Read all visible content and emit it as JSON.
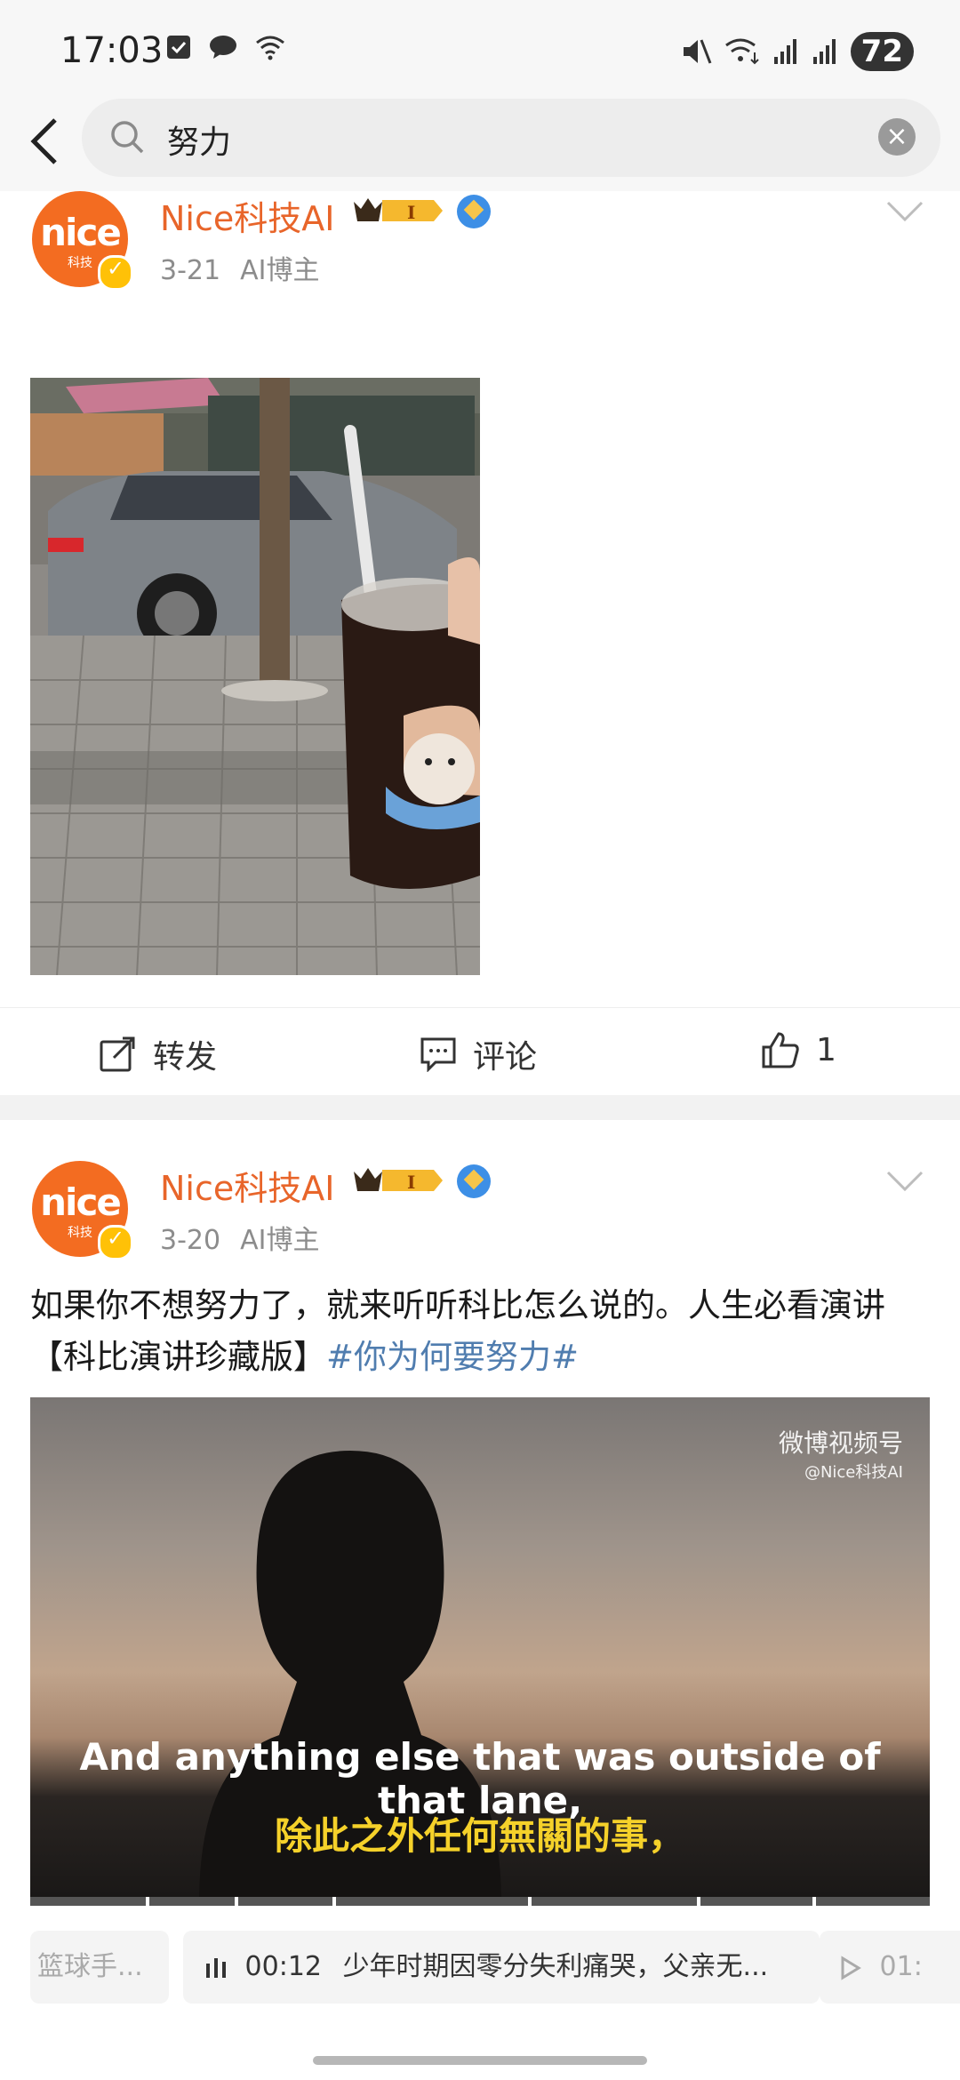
{
  "status_bar": {
    "time": "17:03",
    "battery": "72"
  },
  "search": {
    "query": "努力"
  },
  "posts": [
    {
      "author": "Nice科技AI",
      "avatar_text": "nice",
      "avatar_sub": "科技",
      "date": "3-21",
      "label": "AI博主",
      "actions": {
        "repost": "转发",
        "comment": "评论",
        "like": "1"
      }
    },
    {
      "author": "Nice科技AI",
      "avatar_text": "nice",
      "avatar_sub": "科技",
      "date": "3-20",
      "label": "AI博主",
      "text": "如果你不想努力了，就来听听科比怎么说的。人生必看演讲【科比演讲珍藏版】",
      "topic": "#你为何要努力#",
      "video": {
        "watermark": "微博视频号",
        "watermark_sub": "@Nice科技AI",
        "subtitle_en": "And anything else that was outside of that lane,",
        "subtitle_zh": "除此之外任何無關的事，"
      },
      "chapters": [
        {
          "label": "篮球手..."
        },
        {
          "time": "00:12",
          "label": "少年时期因零分失利痛哭，父亲无..."
        },
        {
          "time": "01:"
        }
      ]
    }
  ],
  "colors": {
    "author": "#e8652a",
    "topic": "#507daf",
    "avatar": "#f36c21"
  }
}
